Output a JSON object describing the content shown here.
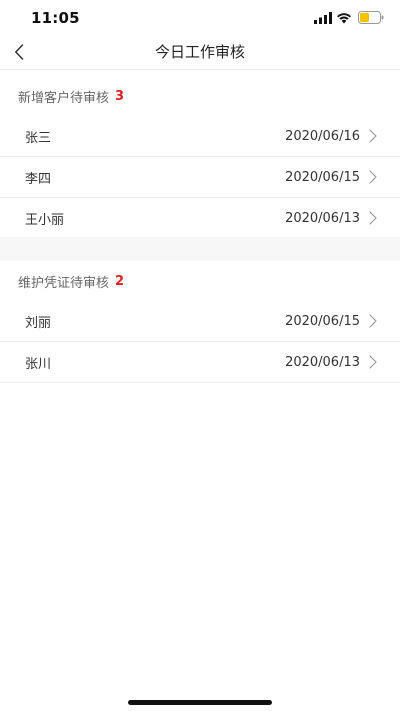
{
  "status_bar": {
    "time": "11:05",
    "icons": [
      "signal-icon",
      "wifi-icon",
      "battery-icon"
    ],
    "battery_color": "#f5c400"
  },
  "nav": {
    "title": "今日工作审核",
    "back_icon": "chevron-left-icon"
  },
  "sections": [
    {
      "title": "新增客户待审核",
      "count": "3",
      "rows": [
        {
          "name": "张三",
          "date": "2020/06/16"
        },
        {
          "name": "李四",
          "date": "2020/06/15"
        },
        {
          "name": "王小丽",
          "date": "2020/06/13"
        }
      ]
    },
    {
      "title": "维护凭证待审核",
      "count": "2",
      "rows": [
        {
          "name": "刘丽",
          "date": "2020/06/15"
        },
        {
          "name": "张川",
          "date": "2020/06/13"
        }
      ]
    }
  ],
  "colors": {
    "count_accent": "#e02020",
    "divider": "#eeeeee",
    "section_gap": "#f7f7f7"
  }
}
